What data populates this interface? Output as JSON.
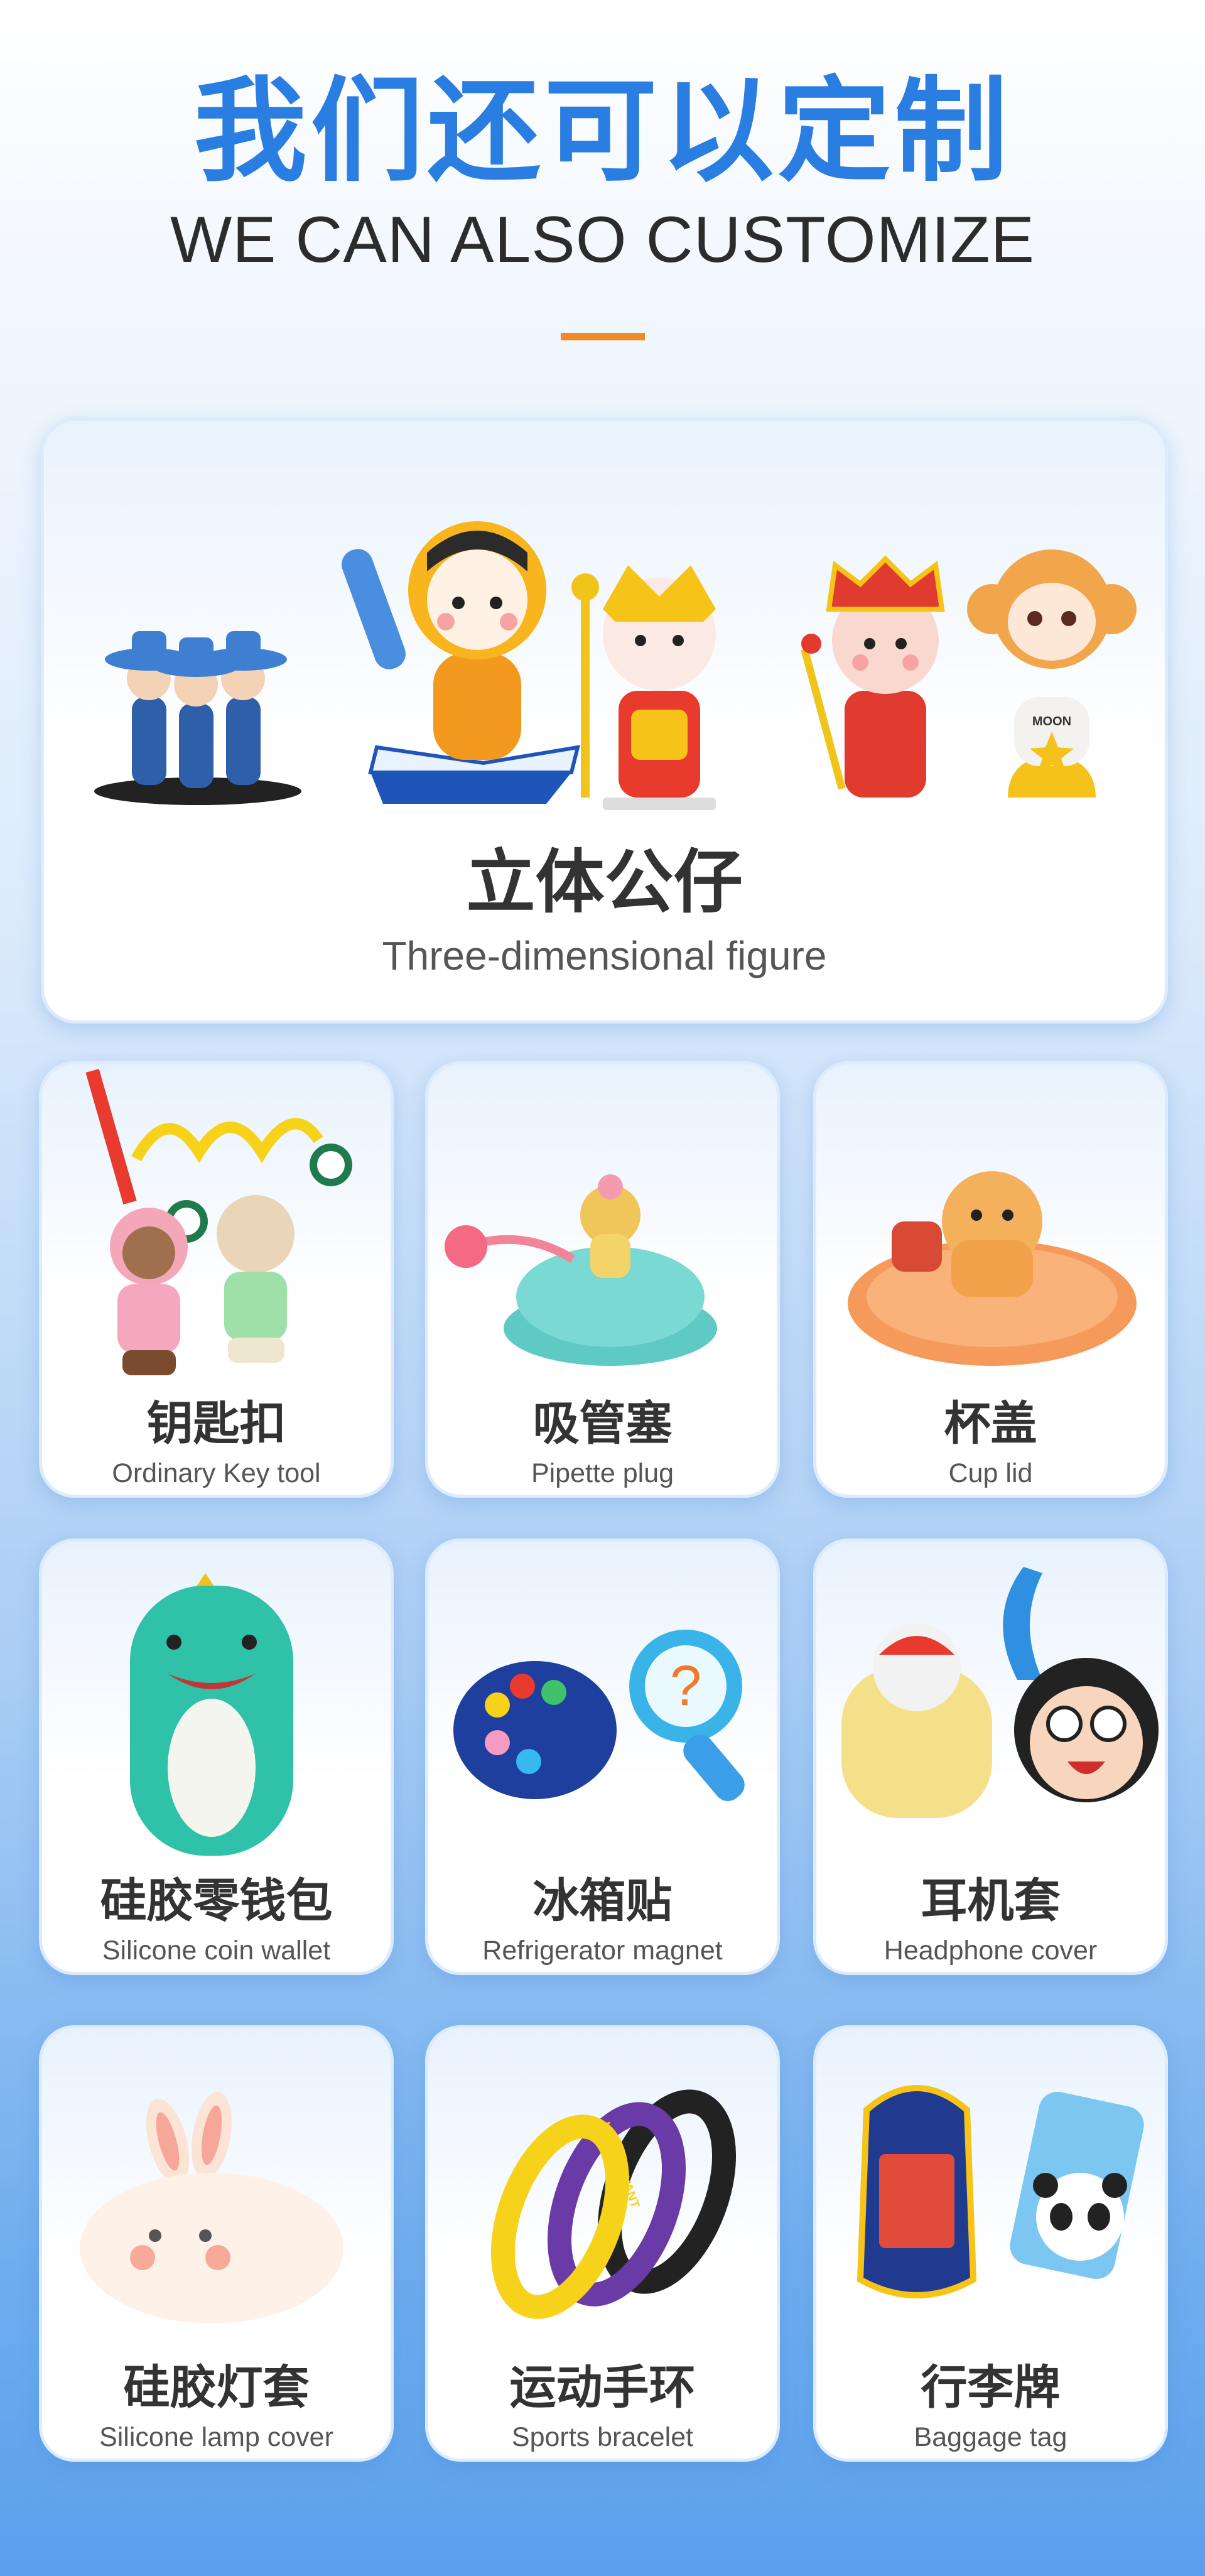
{
  "header": {
    "title_cn": "我们还可以定制",
    "title_en": "WE CAN ALSO CUSTOMIZE"
  },
  "featured": {
    "label_cn": "立体公仔",
    "label_en": "Three-dimensional figure",
    "figure_tag": "MOON"
  },
  "products": [
    {
      "cn": "钥匙扣",
      "en": "Ordinary Key tool"
    },
    {
      "cn": "吸管塞",
      "en": "Pipette plug"
    },
    {
      "cn": "杯盖",
      "en": "Cup lid"
    },
    {
      "cn": "硅胶零钱包",
      "en": "Silicone coin wallet"
    },
    {
      "cn": "冰箱贴",
      "en": "Refrigerator magnet"
    },
    {
      "cn": "耳机套",
      "en": "Headphone cover"
    },
    {
      "cn": "硅胶灯套",
      "en": "Silicone lamp cover"
    },
    {
      "cn": "运动手环",
      "en": "Sports bracelet"
    },
    {
      "cn": "行李牌",
      "en": "Baggage tag"
    }
  ],
  "bracelet_text": "KOBE BRYANT",
  "colors": {
    "title_blue": "#2a7de1",
    "accent_orange": "#f08a24"
  }
}
